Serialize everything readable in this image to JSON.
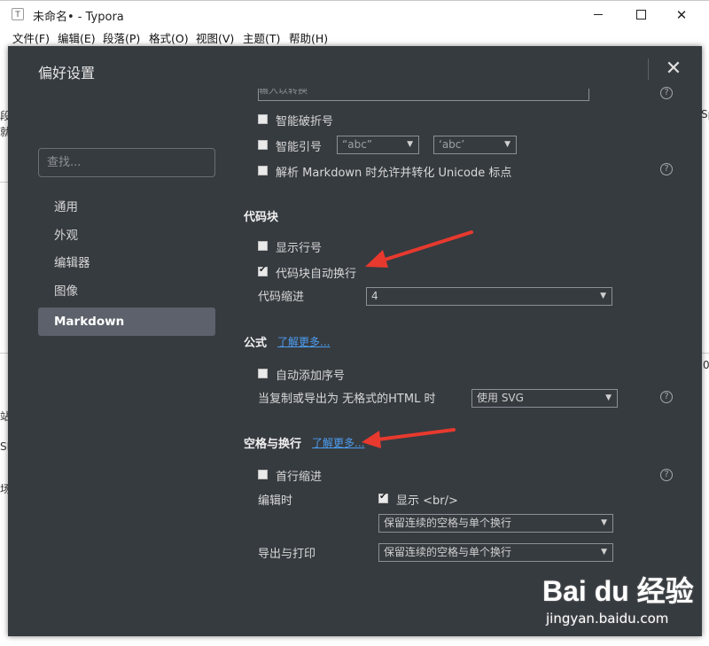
{
  "window": {
    "title": "未命名• - Typora",
    "app_icon_letter": "T"
  },
  "menubar": [
    "文件(F)",
    "编辑(E)",
    "段落(P)",
    "格式(O)",
    "视图(V)",
    "主题(T)",
    "帮助(H)"
  ],
  "background": {
    "left_fragments": [
      "段",
      "就",
      "站",
      "SI",
      "场"
    ],
    "right_fragments": [
      "Sp",
      "0"
    ]
  },
  "watermark": {
    "logo": "Bai du 经验",
    "url": "jingyan.baidu.com"
  },
  "dialog": {
    "title": "偏好设置",
    "search_placeholder": "查找...",
    "nav": [
      "通用",
      "外观",
      "编辑器",
      "图像",
      "Markdown"
    ],
    "active_nav": "Markdown",
    "top_cut_text": "输入以转换",
    "smart_dash_label": "智能破折号",
    "smart_quotes": {
      "label": "智能引号",
      "double": "“abc”",
      "single": "‘abc’"
    },
    "unicode_label": "解析 Markdown 时允许并转化 Unicode 标点",
    "code_block": {
      "title": "代码块",
      "line_numbers_label": "显示行号",
      "line_numbers_checked": false,
      "wrap_label": "代码块自动换行",
      "wrap_checked": true,
      "indent_label": "代码缩进",
      "indent_value": "4"
    },
    "math": {
      "title": "公式",
      "learn_more": "了解更多...",
      "auto_number_label": "自动添加序号",
      "auto_number_checked": false,
      "copy_label": "当复制或导出为 无格式的HTML 时",
      "copy_value": "使用 SVG"
    },
    "whitespace": {
      "title": "空格与换行",
      "learn_more": "了解更多...",
      "indent_first_label": "首行缩进",
      "indent_first_checked": false,
      "editing_label": "编辑时",
      "show_br_label": "显示 <br/>",
      "show_br_checked": true,
      "editing_mode": "保留连续的空格与单个换行",
      "export_label": "导出与打印",
      "export_mode": "保留连续的空格与单个换行"
    },
    "colors": {
      "background": "#363b40",
      "active_nav": "#5c616b",
      "link": "#4d9df0",
      "annotation_arrow": "#e8392e"
    }
  }
}
